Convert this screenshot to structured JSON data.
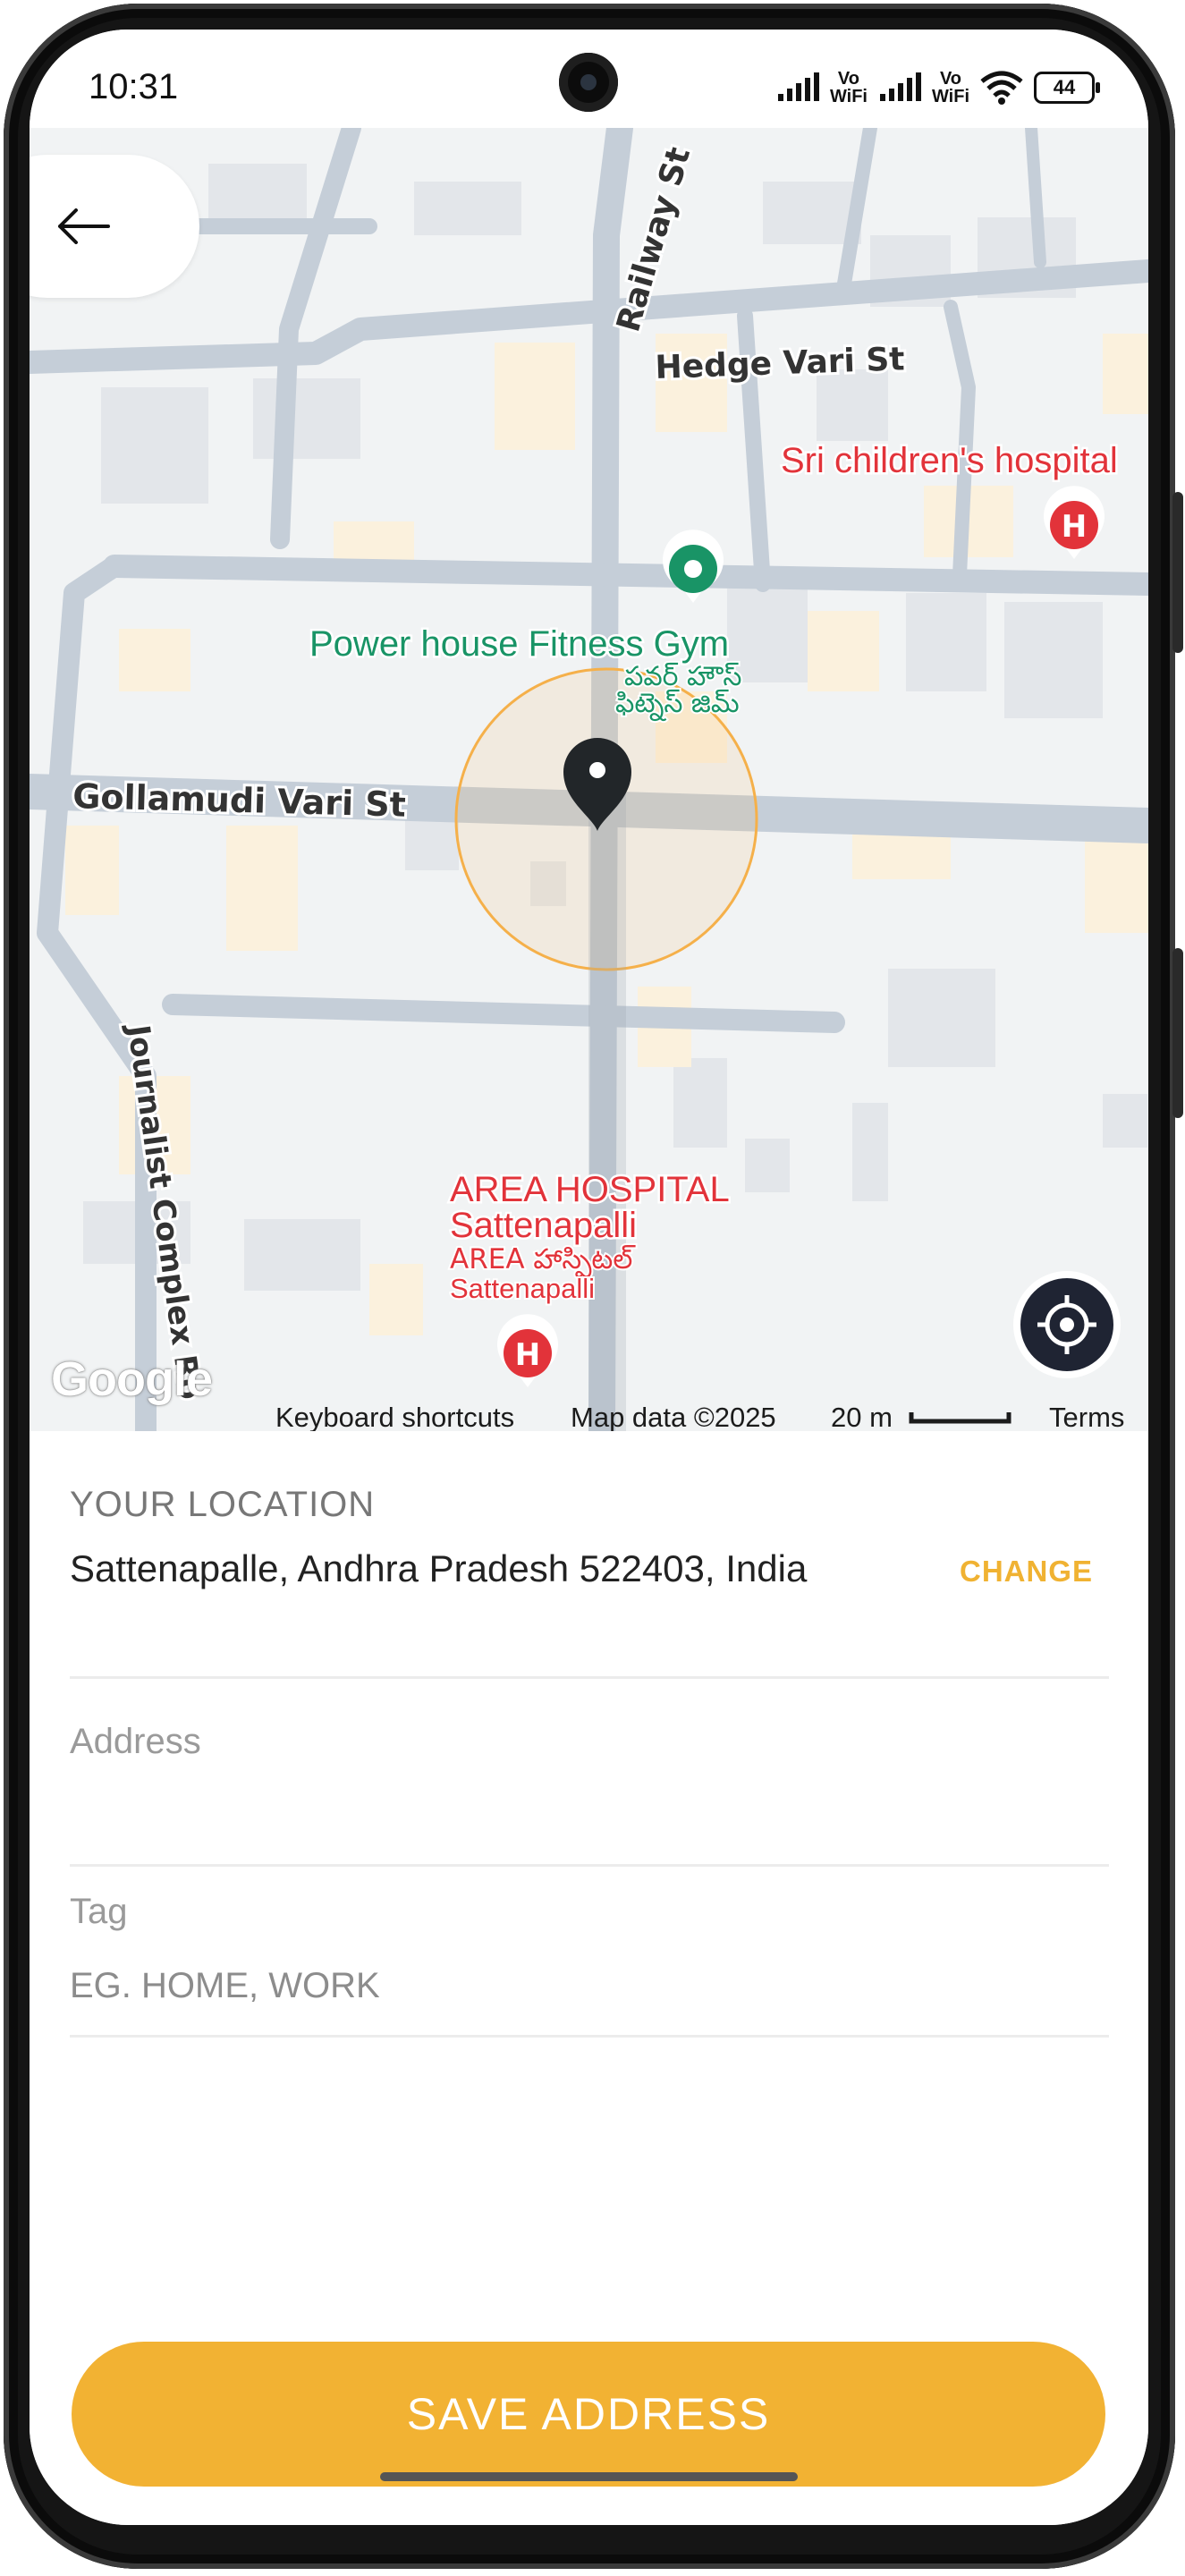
{
  "status_bar": {
    "time": "10:31",
    "vowifi_1": "Vo\nWiFi",
    "vowifi_2": "Vo\nWiFi",
    "battery": "44"
  },
  "map": {
    "street_labels": {
      "railway": "Railway St",
      "hedge": "Hedge Vari St",
      "gollamudi": "Gollamudi Vari St",
      "journalist": "Journalist Complex Ro"
    },
    "places": {
      "gym_name": "Power house Fitness Gym",
      "gym_name_telugu_1": "పవర్ హౌస్",
      "gym_name_telugu_2": "ఫిట్నెస్ జిమ్",
      "childrens_hospital": "Sri children's hospital",
      "area_hospital_1": "AREA HOSPITAL",
      "area_hospital_2": "Sattenapalli",
      "area_hospital_telugu": "AREA హాస్పిటల్",
      "area_hospital_4": "Sattenapalli"
    },
    "attribution": {
      "logo": "Google",
      "keyboard": "Keyboard shortcuts",
      "map_data": "Map data ©2025",
      "scale": "20 m",
      "terms": "Terms"
    },
    "colors": {
      "hospital_red": "#e2333a",
      "gym_green": "#199466",
      "radius_orange": "#f5b04a",
      "pin_dark": "#222629"
    }
  },
  "form": {
    "location_heading": "YOUR LOCATION",
    "location_value": "Sattenapalle, Andhra Pradesh 522403, India",
    "change_label": "CHANGE",
    "address_label": "Address",
    "address_value": "",
    "tag_label": "Tag",
    "tag_placeholder": "EG. HOME, WORK",
    "save_label": "SAVE ADDRESS"
  },
  "icons": {
    "back": "arrow-left",
    "locate": "crosshair",
    "pin": "map-pin",
    "hospital": "hospital-marker",
    "gym": "gym-marker"
  },
  "colors": {
    "accent": "#f2b233"
  }
}
